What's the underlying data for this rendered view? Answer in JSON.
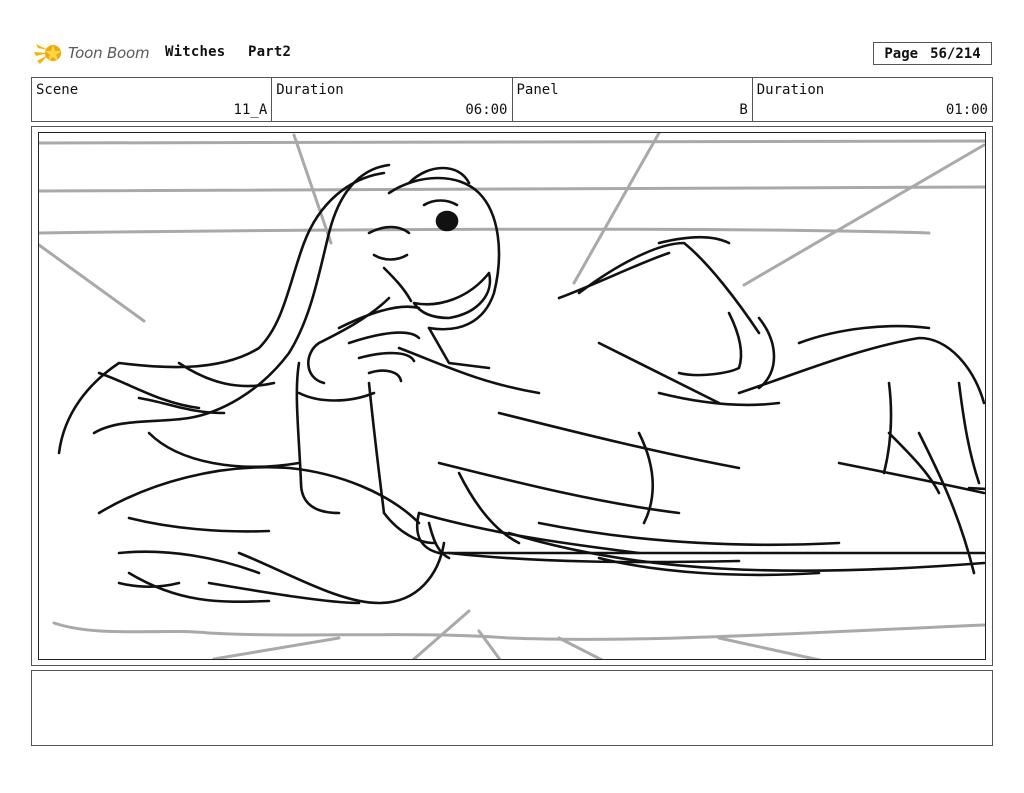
{
  "header": {
    "logo_text": "Toon Boom",
    "project": "Witches",
    "part": "Part2",
    "page_label": "Page",
    "page_number": "56/214"
  },
  "info": {
    "scene_label": "Scene",
    "scene_value": "11_A",
    "scene_duration_label": "Duration",
    "scene_duration_value": "06:00",
    "panel_label": "Panel",
    "panel_value": "B",
    "panel_duration_label": "Duration",
    "panel_duration_value": "01:00"
  },
  "notes": {
    "text": ""
  }
}
